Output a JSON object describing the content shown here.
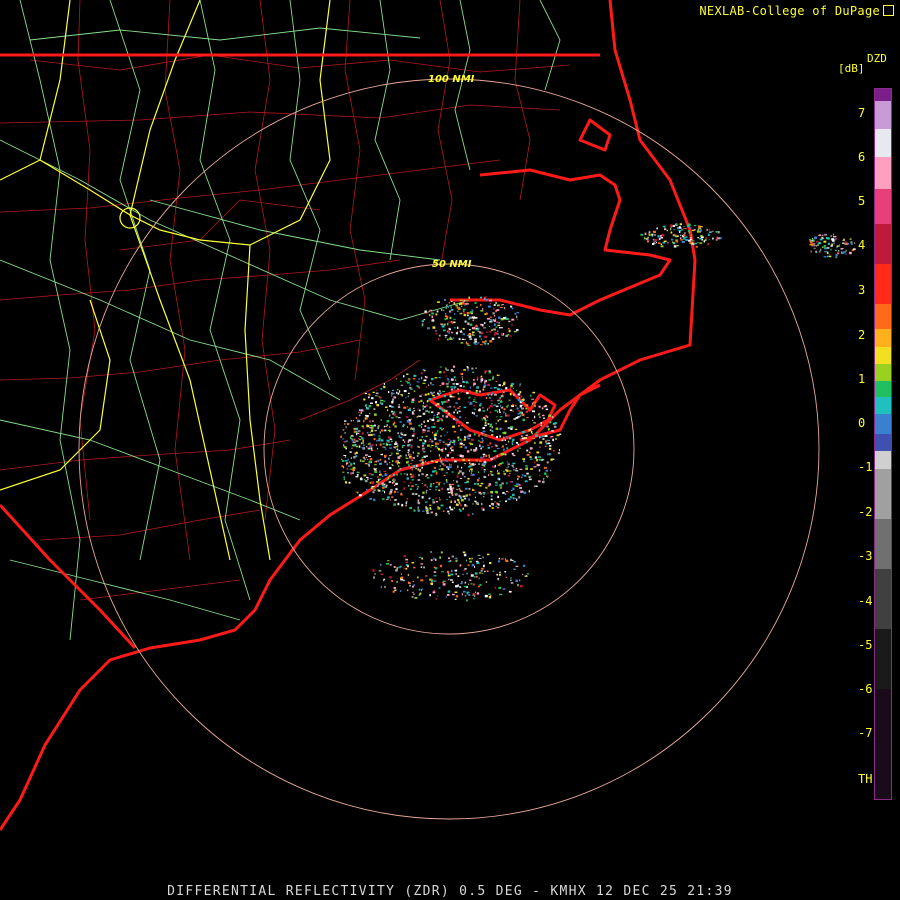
{
  "credit": {
    "text": "NEXLAB-College of DuPage",
    "icon": "corner-logo-icon"
  },
  "legend": {
    "product_code": "DZD",
    "unit": "[dB]",
    "ticks": [
      "7",
      "6",
      "5",
      "4",
      "3",
      "2",
      "1",
      "0",
      "-1",
      "-2",
      "-3",
      "-4",
      "-5",
      "-6",
      "-7",
      "TH"
    ]
  },
  "range_rings": [
    "100 NMI",
    "50 NMI"
  ],
  "footer": "DIFFERENTIAL REFLECTIVITY (ZDR) 0.5 DEG - KMHX 12 DEC 25 21:39",
  "colors": {
    "state_border": "#ff1a1a",
    "county_border": "#b3181e",
    "highway": "#86e08a",
    "interstate": "#ffff33",
    "range_ring": "#e8a898",
    "colorbar_frame": "#8a2b8a"
  }
}
